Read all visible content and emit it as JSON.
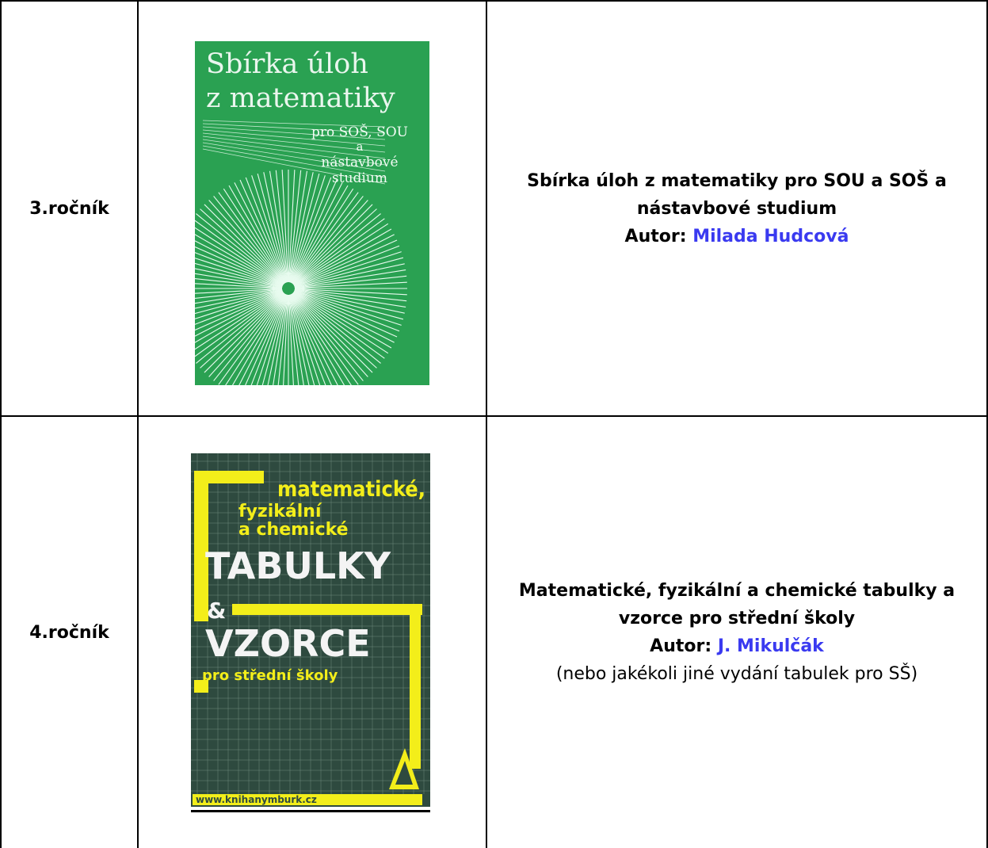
{
  "rows": [
    {
      "grade": "3.ročník",
      "title": "Sbírka úloh z matematiky pro SOU a SOŠ a nástavbové studium",
      "author_prefix": "Autor:",
      "author_name": "Milada Hudcová",
      "note": "",
      "cover": {
        "title_line1": "Sbírka úloh",
        "title_line2": "z matematiky",
        "sub_line1": "pro SOŠ, SOU",
        "sub_line2": "a",
        "sub_line3": "nástavbové",
        "sub_line4": "studium",
        "bg_color": "#2aa152"
      }
    },
    {
      "grade": "4.ročník",
      "title": "Matematické, fyzikální a chemické tabulky a vzorce pro střední školy",
      "author_prefix": "Autor:",
      "author_name": "J. Mikulčák",
      "note": "(nebo jakékoli jiné vydání tabulek pro SŠ)",
      "cover": {
        "line1": "matematické,",
        "line2": "fyzikální",
        "line3": "a chemické",
        "big1": "TABULKY",
        "amp": "&",
        "big2": "VZORCE",
        "sub": "pro střední školy",
        "url": "www.knihanymburk.cz",
        "bg_color": "#2e4a3f",
        "accent_color": "#f3ee1a"
      }
    }
  ]
}
